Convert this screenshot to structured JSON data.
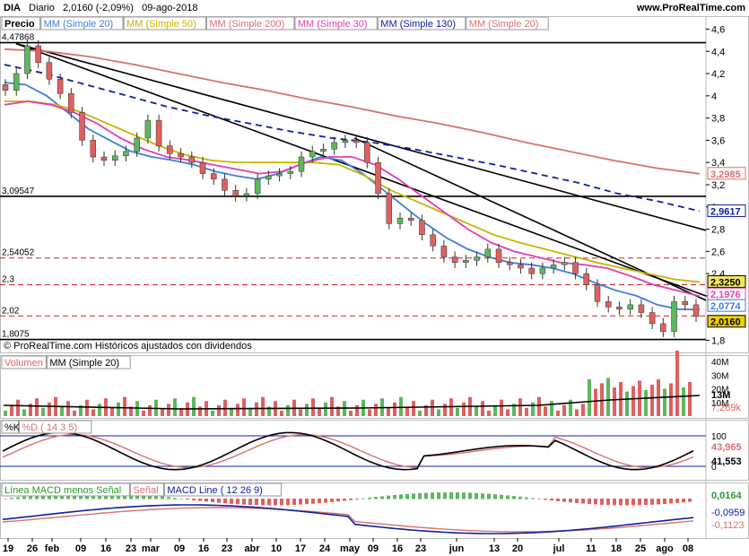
{
  "header": {
    "symbol": "DIA",
    "period": "Diario",
    "price_info": "2,0160 (-2,09%)",
    "date": "09-ago-2018",
    "site": "www.ProRealTime.com"
  },
  "legend": [
    {
      "label": "Precio",
      "color": "#000000"
    },
    {
      "label": "MM (Simple 20)",
      "color": "#3f7fd8"
    },
    {
      "label": "MM (Simple 50)",
      "color": "#c8b400"
    },
    {
      "label": "MM (Simple 200)",
      "color": "#d87070"
    },
    {
      "label": "MM (Simple 30)",
      "color": "#e040b0"
    },
    {
      "label": "MM (Simple 130)",
      "color": "#1020a0"
    },
    {
      "label": "MM (Simple 20)",
      "color": "#d87070"
    }
  ],
  "copyright": "© ProRealTime.com  Históricos ajustados con dividendos",
  "level_labels": [
    "4,47868",
    "3,09547",
    "2,54052",
    "2,3",
    "2,02",
    "1,8075"
  ],
  "price_axis_ticks": [
    "4,6",
    "4,4",
    "4,2",
    "4",
    "3,8",
    "3,6",
    "3,4",
    "3,2",
    "3",
    "2,8",
    "2,6",
    "2,4",
    "2,2",
    "1,8"
  ],
  "price_markers": [
    {
      "text": "3,2985",
      "color": "#d87070",
      "bg": "#ffffff"
    },
    {
      "text": "2,9617",
      "color": "#1020a0",
      "bg": "#ffffff"
    },
    {
      "text": "2,3250",
      "color": "#000000",
      "bg": "#f0e860"
    },
    {
      "text": "2,1976",
      "color": "#e040b0",
      "bg": "#ffffff"
    },
    {
      "text": "2,0774",
      "color": "#3f7fd8",
      "bg": "#ffffff"
    },
    {
      "text": "2,0160",
      "color": "#000000",
      "bg": "#f0d000"
    }
  ],
  "volume": {
    "labels": [
      "Volumen",
      "MM (Simple 20)"
    ],
    "axis_ticks": [
      "40M",
      "30M",
      "20M",
      "10M"
    ],
    "markers": [
      "13M",
      "7,269k"
    ]
  },
  "stoch": {
    "labels": [
      "%K",
      "%D ( 14 3 5)"
    ],
    "axis_ticks": [
      "100",
      "0"
    ],
    "markers": [
      "43,965",
      "41,553"
    ]
  },
  "macd": {
    "labels": [
      "Línea MACD menos Señal",
      "Señal",
      "MACD Line ( 12 26 9)"
    ],
    "markers": [
      "0,0164",
      "-0,0959",
      "-0,1123"
    ]
  },
  "x_axis_labels": [
    "19",
    "26",
    "feb",
    "09",
    "16",
    "23",
    "mar",
    "09",
    "16",
    "23",
    "abr",
    "10",
    "17",
    "24",
    "may",
    "09",
    "16",
    "23",
    "jun",
    "13",
    "20",
    "jul",
    "11",
    "18",
    "25",
    "ago",
    "08"
  ],
  "chart_data": {
    "type": "candlestick",
    "period": "Diario",
    "last_close": 2.016,
    "change_pct": -2.09,
    "series": [
      {
        "name": "Precio",
        "kind": "candles",
        "approx_closes": [
          4.05,
          4.2,
          4.45,
          4.3,
          4.15,
          4.02,
          3.85,
          3.6,
          3.45,
          3.42,
          3.46,
          3.5,
          3.62,
          3.78,
          3.55,
          3.48,
          3.45,
          3.4,
          3.3,
          3.25,
          3.15,
          3.1,
          3.12,
          3.25,
          3.28,
          3.3,
          3.32,
          3.45,
          3.5,
          3.52,
          3.58,
          3.6,
          3.58,
          3.4,
          3.12,
          2.85,
          2.9,
          2.88,
          2.75,
          2.65,
          2.55,
          2.5,
          2.52,
          2.55,
          2.62,
          2.5,
          2.48,
          2.45,
          2.4,
          2.45,
          2.48,
          2.5,
          2.4,
          2.3,
          2.15,
          2.1,
          2.08,
          2.12,
          2.05,
          1.95,
          1.88,
          2.15,
          2.12,
          2.016
        ]
      },
      {
        "name": "MM (Simple 20)",
        "approx_values": [
          4.12,
          4.1,
          4.0,
          3.85,
          3.7,
          3.6,
          3.5,
          3.45,
          3.42,
          3.38,
          3.32,
          3.28,
          3.25,
          3.3,
          3.38,
          3.45,
          3.42,
          3.3,
          3.15,
          3.0,
          2.85,
          2.72,
          2.62,
          2.55,
          2.5,
          2.48,
          2.45,
          2.4,
          2.32,
          2.25,
          2.2,
          2.12,
          2.08,
          2.077
        ]
      },
      {
        "name": "MM (Simple 50)",
        "approx_values": [
          3.95,
          3.95,
          3.92,
          3.85,
          3.75,
          3.65,
          3.55,
          3.47,
          3.42,
          3.4,
          3.4,
          3.4,
          3.4,
          3.38,
          3.28,
          3.15,
          3.05,
          2.95,
          2.85,
          2.75,
          2.68,
          2.62,
          2.56,
          2.5,
          2.45,
          2.4,
          2.35,
          2.325
        ]
      },
      {
        "name": "MM (Simple 30)",
        "approx_values": [
          3.92,
          3.95,
          3.92,
          3.85,
          3.75,
          3.62,
          3.52,
          3.45,
          3.42,
          3.38,
          3.34,
          3.3,
          3.32,
          3.4,
          3.45,
          3.45,
          3.38,
          3.25,
          3.1,
          2.95,
          2.8,
          2.68,
          2.6,
          2.55,
          2.5,
          2.48,
          2.45,
          2.38,
          2.3,
          2.25,
          2.198
        ]
      },
      {
        "name": "MM (Simple 130)",
        "approx_values": [
          4.28,
          4.2,
          4.1,
          4.0,
          3.9,
          3.82,
          3.75,
          3.68,
          3.62,
          3.58,
          3.52,
          3.45,
          3.38,
          3.3,
          3.22,
          3.12,
          3.05,
          2.962
        ]
      },
      {
        "name": "MM (Simple 200)",
        "approx_values": [
          4.42,
          4.4,
          4.35,
          4.28,
          4.2,
          4.12,
          4.05,
          3.97,
          3.9,
          3.82,
          3.75,
          3.67,
          3.58,
          3.5,
          3.42,
          3.35,
          3.2985
        ]
      }
    ],
    "horizontal_levels": [
      4.47868,
      3.09547,
      2.54052,
      2.3,
      2.02,
      1.8075
    ],
    "trendlines": "three descending lines from the ~4.47 top; levels 2.54/2.3/2.02 dashed",
    "y_range": [
      1.78,
      4.62
    ],
    "stochastic": {
      "k": 43.965,
      "d": 41.553,
      "range": [
        0,
        100
      ]
    },
    "macd": {
      "histogram": 0.0164,
      "macd": -0.0959,
      "signal": -0.1123
    }
  }
}
